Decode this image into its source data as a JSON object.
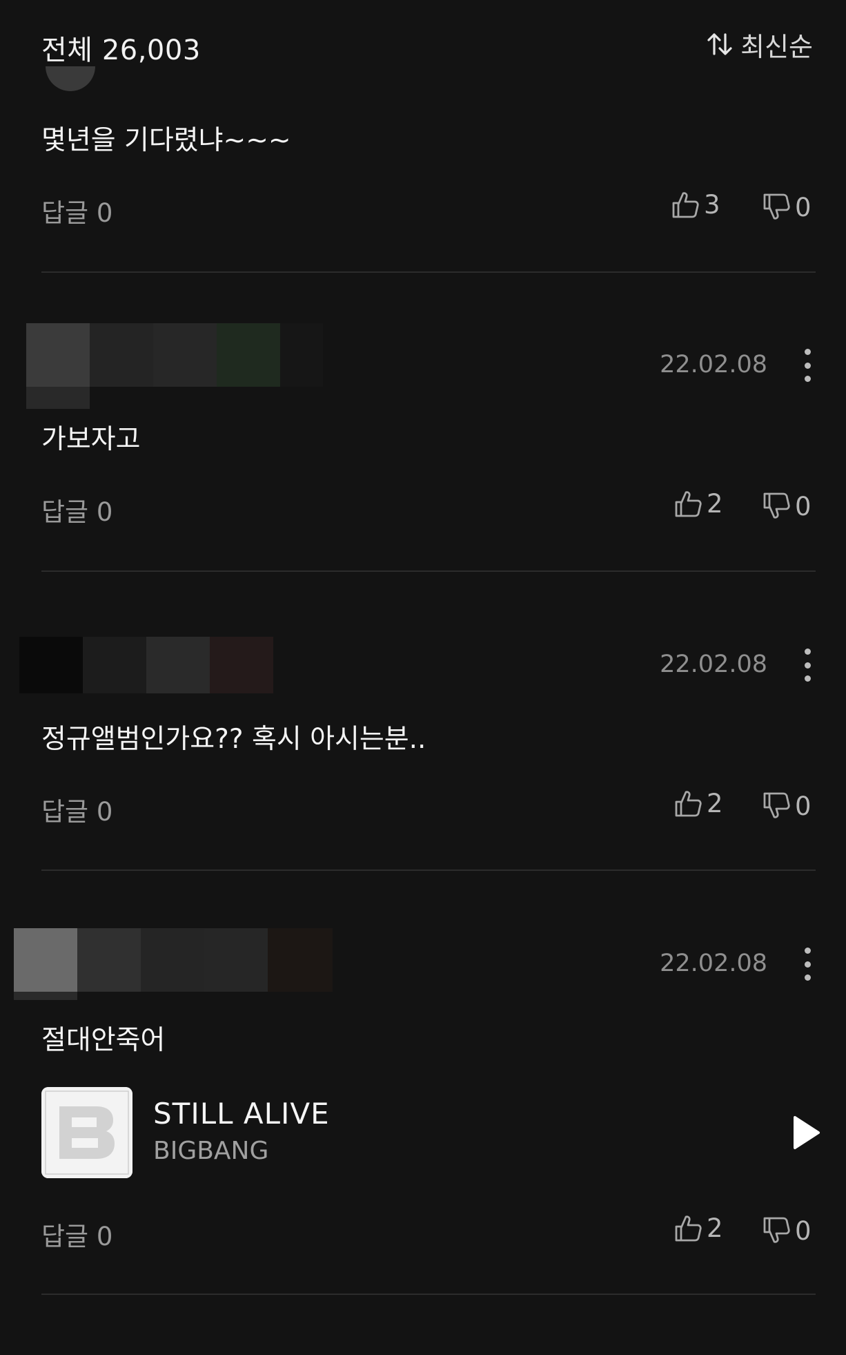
{
  "header": {
    "total_label": "전체 26,003",
    "sort_label": "최신순",
    "sort_icon": "sort-arrows-icon"
  },
  "comments": [
    {
      "text": "몇년을 기다렸냐~~~",
      "reply_label": "답글 0",
      "likes": "3",
      "dislikes": "0"
    },
    {
      "date": "22.02.08",
      "text": "가보자고",
      "reply_label": "답글 0",
      "likes": "2",
      "dislikes": "0"
    },
    {
      "date": "22.02.08",
      "text": "정규앨범인가요?? 혹시 아시는분..",
      "reply_label": "답글 0",
      "likes": "2",
      "dislikes": "0"
    },
    {
      "date": "22.02.08",
      "text": "절대안죽어",
      "song": {
        "title": "STILL ALIVE",
        "artist": "BIGBANG",
        "art_label": "BIGBANG"
      },
      "reply_label": "답글 0",
      "likes": "2",
      "dislikes": "0"
    }
  ],
  "colors": {
    "background": "#131313",
    "text_primary": "#f2f2f2",
    "text_secondary": "#9a9a9a",
    "divider": "#2c2c2c"
  }
}
